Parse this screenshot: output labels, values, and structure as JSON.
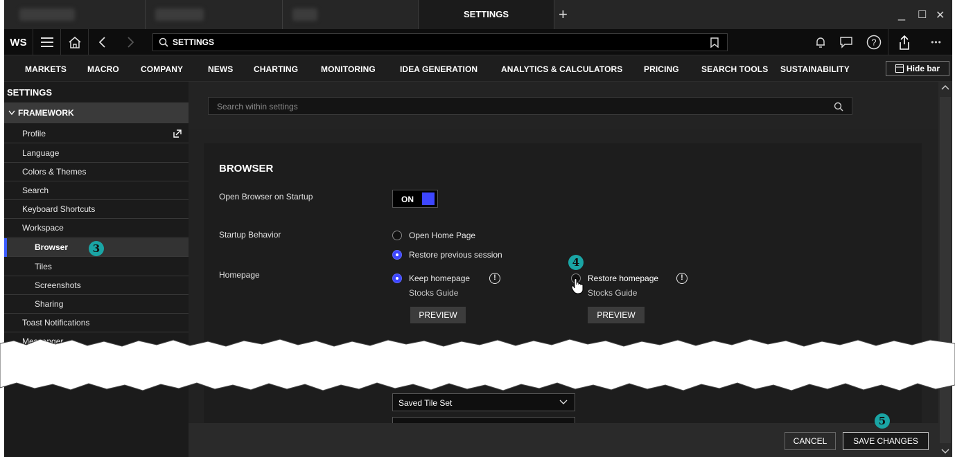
{
  "titlebar": {
    "active_tab": "SETTINGS",
    "new_tab_symbol": "+",
    "minimize": "_",
    "maximize": "☐",
    "close": "✕"
  },
  "toolbar": {
    "logo": "WS",
    "address": "SETTINGS"
  },
  "menu": [
    "MARKETS",
    "MACRO",
    "COMPANY",
    "NEWS",
    "CHARTING",
    "MONITORING",
    "IDEA GENERATION",
    "ANALYTICS & CALCULATORS",
    "PRICING",
    "SEARCH TOOLS",
    "SUSTAINABILITY"
  ],
  "hide_bar": "Hide bar",
  "sidebar": {
    "title": "SETTINGS",
    "group": "FRAMEWORK",
    "items": [
      "Profile",
      "Language",
      "Colors & Themes",
      "Search",
      "Keyboard Shortcuts",
      "Workspace"
    ],
    "subitems": [
      "Browser",
      "Tiles",
      "Screenshots",
      "Sharing"
    ],
    "items_after": [
      "Toast Notifications",
      "Messenger"
    ]
  },
  "search": {
    "placeholder": "Search within settings"
  },
  "browser": {
    "heading": "BROWSER",
    "open_on_startup_label": "Open Browser on Startup",
    "toggle_value": "ON",
    "startup_behavior_label": "Startup Behavior",
    "startup_options": [
      "Open Home Page",
      "Restore previous session"
    ],
    "homepage_label": "Homepage",
    "keep_homepage": "Keep homepage",
    "keep_homepage_sub": "Stocks Guide",
    "restore_homepage": "Restore homepage",
    "restore_homepage_sub": "Stocks Guide",
    "info_symbol": "!",
    "preview": "PREVIEW",
    "saved_tile_set": "Saved Tile Set"
  },
  "footer": {
    "cancel": "CANCEL",
    "save": "SAVE CHANGES"
  },
  "badges": [
    "3",
    "4",
    "5"
  ],
  "colors": {
    "accent": "#3d46ff",
    "badge": "#1aa5a5",
    "background": "#1b1b1b"
  }
}
